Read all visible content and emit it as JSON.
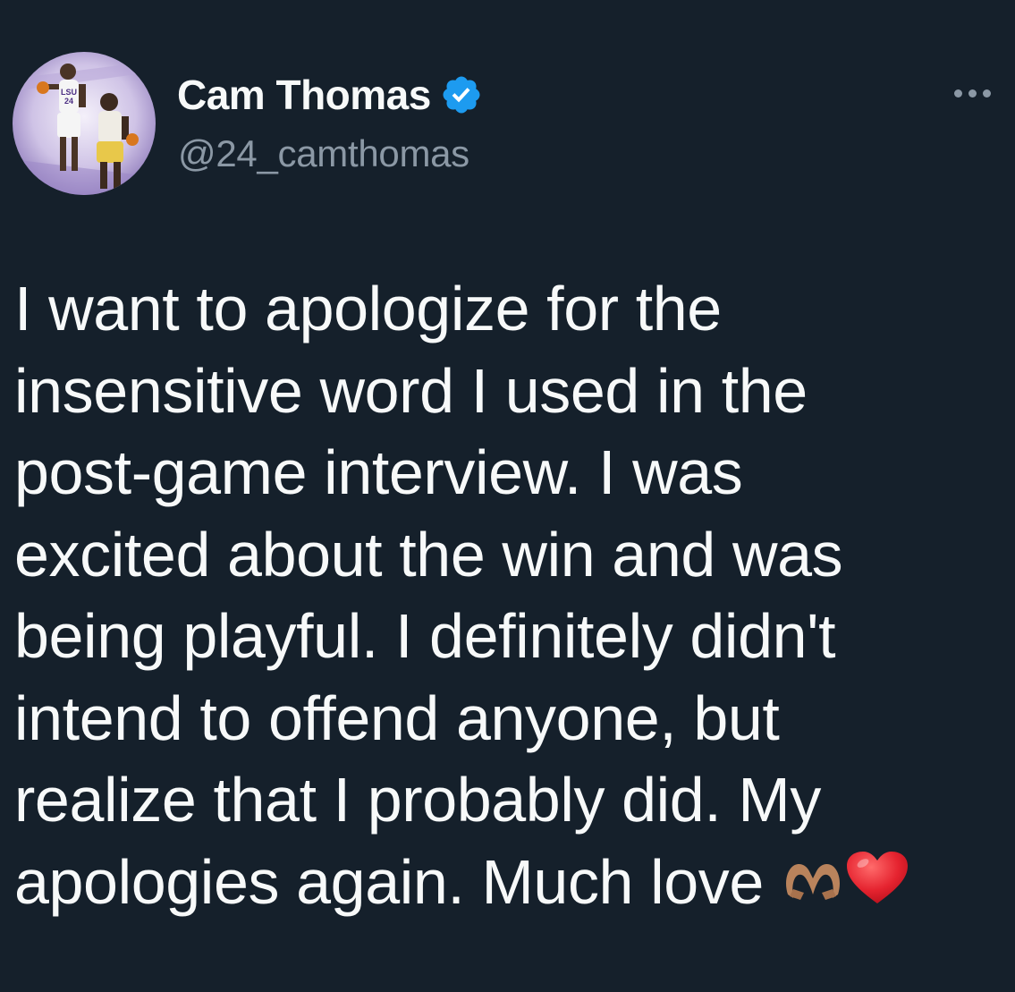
{
  "author": {
    "display_name": "Cam Thomas",
    "handle": "@24_camthomas",
    "verified": true,
    "avatar_jersey_text": "LSU",
    "avatar_jersey_number": "24"
  },
  "tweet": {
    "lines": [
      "I want to apologize for the",
      "insensitive word I used in the",
      "post-game interview. I was",
      "excited about the win and was",
      "being playful. I definitely didn't",
      "intend to offend anyone, but",
      "realize that I probably did. My",
      "apologies again. Much love"
    ],
    "emojis": [
      "heart-hands",
      "red-heart"
    ]
  },
  "colors": {
    "background": "#15202b",
    "text_primary": "#f7f9f9",
    "text_secondary": "#8b98a5",
    "verified_badge": "#1d9bf0"
  },
  "icons": {
    "verified": "verified-badge-icon",
    "more": "more-options-icon"
  }
}
